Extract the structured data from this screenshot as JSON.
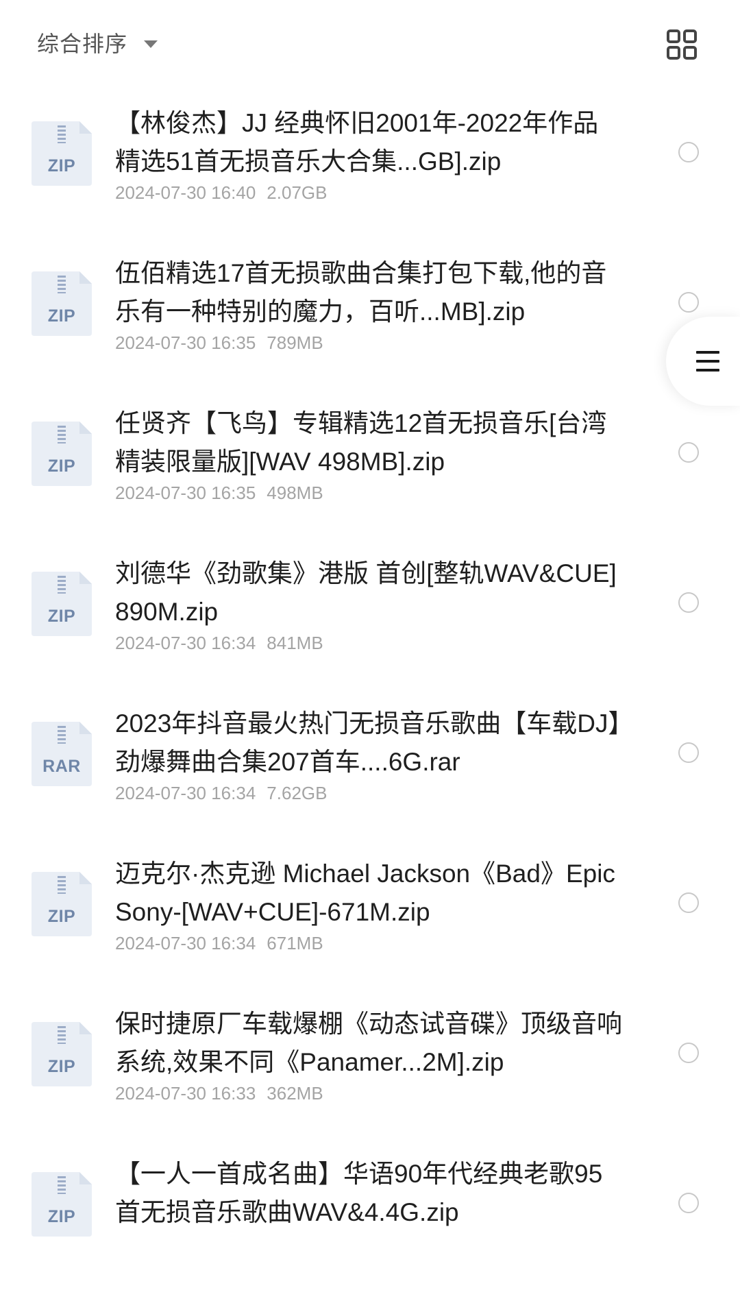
{
  "header": {
    "sort_label": "综合排序",
    "sort_caret_icon": "caret-down-icon",
    "view_toggle_icon": "grid-view-icon"
  },
  "side_tab": {
    "icon": "menu-icon"
  },
  "files": [
    {
      "name": "【林俊杰】JJ 经典怀旧2001年-2022年作品精选51首无损音乐大合集...GB].zip",
      "ext": "ZIP",
      "date": "2024-07-30 16:40",
      "size": "2.07GB"
    },
    {
      "name": "伍佰精选17首无损歌曲合集打包下载,他的音乐有一种特别的魔力，百听...MB].zip",
      "ext": "ZIP",
      "date": "2024-07-30 16:35",
      "size": "789MB"
    },
    {
      "name": "任贤齐【飞鸟】专辑精选12首无损音乐[台湾精装限量版][WAV 498MB].zip",
      "ext": "ZIP",
      "date": "2024-07-30 16:35",
      "size": "498MB"
    },
    {
      "name": "刘德华《劲歌集》港版 首创[整轨WAV&CUE] 890M.zip",
      "ext": "ZIP",
      "date": "2024-07-30 16:34",
      "size": "841MB"
    },
    {
      "name": "2023年抖音最火热门无损音乐歌曲【车载DJ】劲爆舞曲合集207首车....6G.rar",
      "ext": "RAR",
      "date": "2024-07-30 16:34",
      "size": "7.62GB"
    },
    {
      "name": "迈克尔·杰克逊 Michael Jackson《Bad》EpicSony-[WAV+CUE]-671M.zip",
      "ext": "ZIP",
      "date": "2024-07-30 16:34",
      "size": "671MB"
    },
    {
      "name": "保时捷原厂车载爆棚《动态试音碟》顶级音响系统,效果不同《Panamer...2M].zip",
      "ext": "ZIP",
      "date": "2024-07-30 16:33",
      "size": "362MB"
    },
    {
      "name": "【一人一首成名曲】华语90年代经典老歌95首无损音乐歌曲WAV&4.4G.zip",
      "ext": "ZIP",
      "date": "",
      "size": ""
    }
  ],
  "colors": {
    "file_icon_bg": "#e9eef5",
    "file_icon_label": "#6f86a8",
    "text_primary": "#1f1f1f",
    "text_meta": "#a4a4a4",
    "radio_border": "#c8c8c8"
  }
}
